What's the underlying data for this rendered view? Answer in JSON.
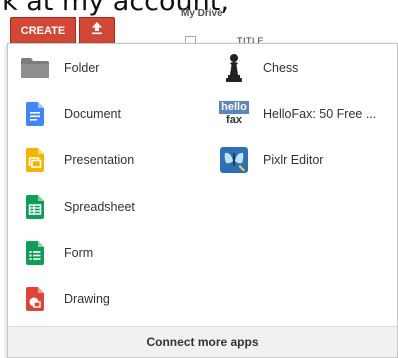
{
  "caption": "k at my account,",
  "toolbar": {
    "create_label": "CREATE",
    "upload_icon": "upload-icon",
    "accent": "#d14836"
  },
  "background": {
    "my_drive": "My Drive",
    "title_header": "TITLE"
  },
  "menu": {
    "left_items": [
      {
        "label": "Folder",
        "icon": "folder-icon"
      },
      {
        "label": "Document",
        "icon": "document-icon"
      },
      {
        "label": "Presentation",
        "icon": "presentation-icon"
      },
      {
        "label": "Spreadsheet",
        "icon": "spreadsheet-icon"
      },
      {
        "label": "Form",
        "icon": "form-icon"
      },
      {
        "label": "Drawing",
        "icon": "drawing-icon"
      }
    ],
    "right_items": [
      {
        "label": "Chess",
        "icon": "chess-icon"
      },
      {
        "label": "HelloFax: 50 Free ...",
        "icon": "hellofax-icon",
        "icon_text_top": "hello",
        "icon_text_bottom": "fax"
      },
      {
        "label": "Pixlr Editor",
        "icon": "pixlr-icon"
      }
    ],
    "footer": "Connect more apps"
  },
  "colors": {
    "document": "#4285f4",
    "presentation": "#f4b400",
    "spreadsheet": "#0f9d58",
    "form": "#0f9d58",
    "drawing": "#db4437",
    "folder": "#8a8a8a"
  }
}
